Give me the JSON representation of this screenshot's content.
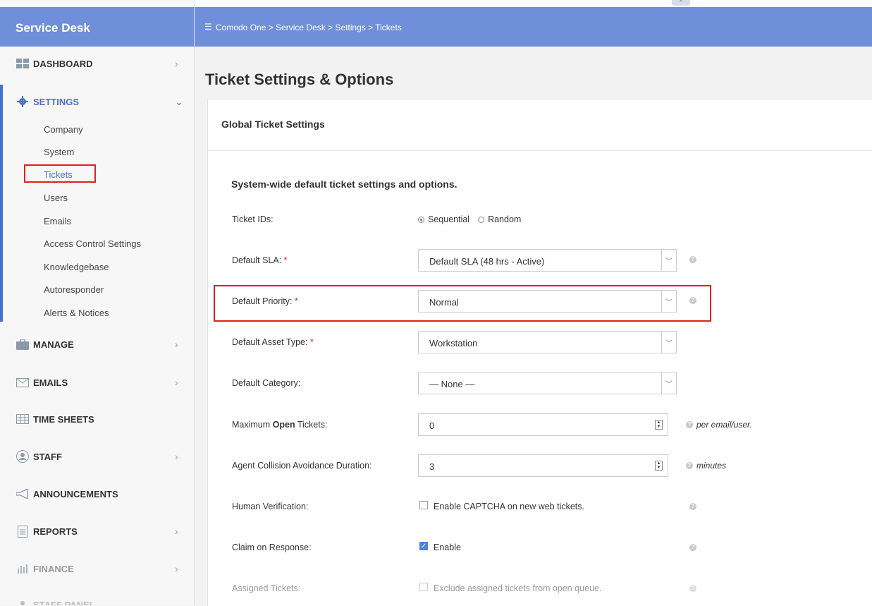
{
  "sidebar": {
    "brand": "Service Desk",
    "nav": [
      {
        "label": "DASHBOARD",
        "icon": "grid-icon"
      },
      {
        "label": "SETTINGS",
        "icon": "gear-icon"
      },
      {
        "label": "MANAGE",
        "icon": "briefcase-icon"
      },
      {
        "label": "EMAILS",
        "icon": "envelope-icon"
      },
      {
        "label": "TIME SHEETS",
        "icon": "table-icon"
      },
      {
        "label": "STAFF",
        "icon": "user-icon"
      },
      {
        "label": "ANNOUNCEMENTS",
        "icon": "megaphone-icon"
      },
      {
        "label": "REPORTS",
        "icon": "document-icon"
      },
      {
        "label": "FINANCE",
        "icon": "bar-chart-icon"
      },
      {
        "label": "STAFF PANEL",
        "icon": "user-icon"
      }
    ],
    "settings_sub": [
      "Company",
      "System",
      "Tickets",
      "Users",
      "Emails",
      "Access Control Settings",
      "Knowledgebase",
      "Autoresponder",
      "Alerts & Notices"
    ]
  },
  "topbar": {
    "breadcrumb": "Comodo One  >  Service Desk  >  Settings  >  Tickets",
    "collapse_glyph": "^"
  },
  "main": {
    "page_title": "Ticket Settings & Options",
    "card_title": "Global Ticket Settings",
    "section_title": "System-wide default ticket settings and options.",
    "ticket_ids": {
      "label": "Ticket IDs:",
      "options": [
        "Sequential",
        "Random"
      ],
      "selected": "Sequential"
    },
    "default_sla": {
      "label": "Default SLA:",
      "value": "Default SLA (48 hrs - Active)"
    },
    "default_priority": {
      "label": "Default Priority:",
      "value": "Normal"
    },
    "default_asset_type": {
      "label": "Default Asset Type:",
      "value": "Workstation"
    },
    "default_category": {
      "label": "Default Category:",
      "value": "— None —"
    },
    "max_open_tickets": {
      "label_pre": "Maximum ",
      "label_bold": "Open",
      "label_post": " Tickets:",
      "value": "0",
      "unit": "per email/user."
    },
    "collision_duration": {
      "label": "Agent Collision Avoidance Duration:",
      "value": "3",
      "unit": "minutes"
    },
    "human_verification": {
      "label": "Human Verification:",
      "checkbox_label": "Enable CAPTCHA on new web tickets.",
      "checked": false
    },
    "claim_on_response": {
      "label": "Claim on Response:",
      "checkbox_label": "Enable",
      "checked": true
    },
    "assigned_tickets": {
      "label": "Assigned Tickets:",
      "checkbox_label": "Exclude assigned tickets from open queue.",
      "checked": false
    },
    "required_mark": "*",
    "help_glyph": "?"
  }
}
